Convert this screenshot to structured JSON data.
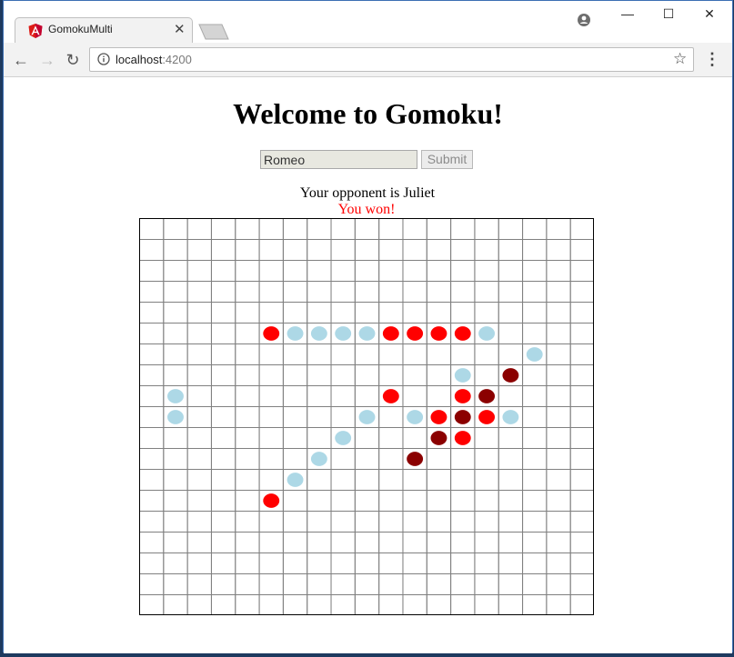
{
  "browser": {
    "tab_title": "GomokuMulti",
    "url_host": "localhost",
    "url_port": ":4200",
    "window_controls": {
      "minimize": "—",
      "maximize": "☐",
      "close": "✕"
    }
  },
  "page": {
    "title": "Welcome to Gomoku!",
    "name_input_value": "Romeo",
    "submit_label": "Submit",
    "opponent_text": "Your opponent is Juliet",
    "result_text": "You won!"
  },
  "board": {
    "cols": 19,
    "rows": 19,
    "colors": {
      "red": "#ff0000",
      "blue": "#add8e6",
      "dark": "#8b0000",
      "grid": "#808080"
    },
    "stones": [
      {
        "col": 5,
        "row": 5,
        "color": "red"
      },
      {
        "col": 6,
        "row": 5,
        "color": "blue"
      },
      {
        "col": 7,
        "row": 5,
        "color": "blue"
      },
      {
        "col": 8,
        "row": 5,
        "color": "blue"
      },
      {
        "col": 9,
        "row": 5,
        "color": "blue"
      },
      {
        "col": 10,
        "row": 5,
        "color": "red"
      },
      {
        "col": 11,
        "row": 5,
        "color": "red"
      },
      {
        "col": 12,
        "row": 5,
        "color": "red"
      },
      {
        "col": 13,
        "row": 5,
        "color": "red"
      },
      {
        "col": 14,
        "row": 5,
        "color": "blue"
      },
      {
        "col": 16,
        "row": 6,
        "color": "blue"
      },
      {
        "col": 13,
        "row": 7,
        "color": "blue"
      },
      {
        "col": 15,
        "row": 7,
        "color": "dark"
      },
      {
        "col": 1,
        "row": 8,
        "color": "blue"
      },
      {
        "col": 10,
        "row": 8,
        "color": "red"
      },
      {
        "col": 13,
        "row": 8,
        "color": "red"
      },
      {
        "col": 14,
        "row": 8,
        "color": "dark"
      },
      {
        "col": 1,
        "row": 9,
        "color": "blue"
      },
      {
        "col": 9,
        "row": 9,
        "color": "blue"
      },
      {
        "col": 11,
        "row": 9,
        "color": "blue"
      },
      {
        "col": 12,
        "row": 9,
        "color": "red"
      },
      {
        "col": 13,
        "row": 9,
        "color": "dark"
      },
      {
        "col": 14,
        "row": 9,
        "color": "red"
      },
      {
        "col": 15,
        "row": 9,
        "color": "blue"
      },
      {
        "col": 8,
        "row": 10,
        "color": "blue"
      },
      {
        "col": 12,
        "row": 10,
        "color": "dark"
      },
      {
        "col": 13,
        "row": 10,
        "color": "red"
      },
      {
        "col": 7,
        "row": 11,
        "color": "blue"
      },
      {
        "col": 11,
        "row": 11,
        "color": "dark"
      },
      {
        "col": 6,
        "row": 12,
        "color": "blue"
      },
      {
        "col": 5,
        "row": 13,
        "color": "red"
      }
    ]
  }
}
